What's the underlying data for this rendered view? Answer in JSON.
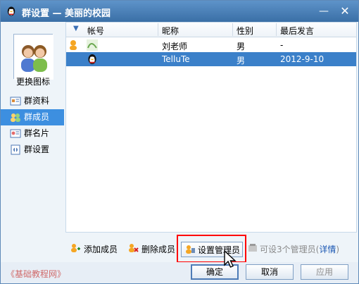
{
  "window": {
    "title": "群设置 — 美丽的校园",
    "min_icon": "minimize-icon",
    "close_icon": "close-icon"
  },
  "sidebar": {
    "change_icon_label": "更换图标",
    "items": [
      {
        "label": "群资料",
        "icon": "group-info-icon"
      },
      {
        "label": "群成员",
        "icon": "group-members-icon"
      },
      {
        "label": "群名片",
        "icon": "group-card-icon"
      },
      {
        "label": "群设置",
        "icon": "group-settings-icon"
      }
    ]
  },
  "table": {
    "columns": [
      "帐号",
      "昵称",
      "性别",
      "最后发言"
    ],
    "rows": [
      {
        "account": "",
        "nickname": "刘老师",
        "gender": "男",
        "last_speak": "-"
      },
      {
        "account": "",
        "nickname": "TelluTe",
        "gender": "男",
        "last_speak": "2012-9-10"
      }
    ]
  },
  "actions": {
    "add_member": "添加成员",
    "remove_member": "删除成员",
    "set_admin": "设置管理员",
    "admin_limit_prefix": "可设3个管理员(",
    "details": "详情",
    "admin_limit_suffix": ")"
  },
  "footer": {
    "watermark": "《基础教程网》",
    "ok": "确定",
    "cancel": "取消",
    "apply": "应用"
  },
  "colors": {
    "title_start": "#5e93c9",
    "title_end": "#3a6fa6",
    "selection": "#3b80c9",
    "highlight": "#ff0000"
  }
}
